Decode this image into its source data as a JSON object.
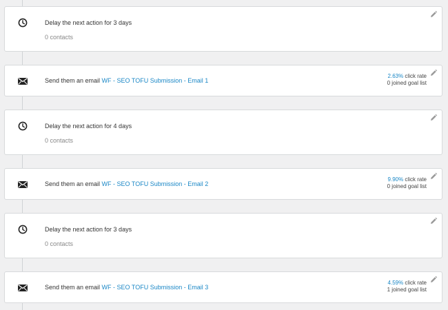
{
  "steps": [
    {
      "type": "delay",
      "icon": "clock-icon",
      "text": "Delay the next action for 3 days",
      "contacts": "0 contacts"
    },
    {
      "type": "email",
      "icon": "envelope-icon",
      "prefix": "Send them an email ",
      "link": "WF - SEO TOFU Submission - Email 1",
      "rate": "2.63%",
      "rate_suffix": " click rate",
      "goal": "0 joined goal list"
    },
    {
      "type": "delay",
      "icon": "clock-icon",
      "text": "Delay the next action for 4 days",
      "contacts": "0 contacts"
    },
    {
      "type": "email",
      "icon": "envelope-icon",
      "prefix": "Send them an email ",
      "link": "WF - SEO TOFU Submission - Email 2",
      "rate": "9.90%",
      "rate_suffix": " click rate",
      "goal": "0 joined goal list"
    },
    {
      "type": "delay",
      "icon": "clock-icon",
      "text": "Delay the next action for 3 days",
      "contacts": "0 contacts"
    },
    {
      "type": "email",
      "icon": "envelope-icon",
      "prefix": "Send them an email ",
      "link": "WF - SEO TOFU Submission - Email 3",
      "rate": "4.59%",
      "rate_suffix": " click rate",
      "goal": "1 joined goal list"
    }
  ],
  "edit_icon": "pencil-icon",
  "colors": {
    "link": "#1a87c6",
    "background": "#f0f0f1",
    "card_border": "#d7d9db"
  }
}
